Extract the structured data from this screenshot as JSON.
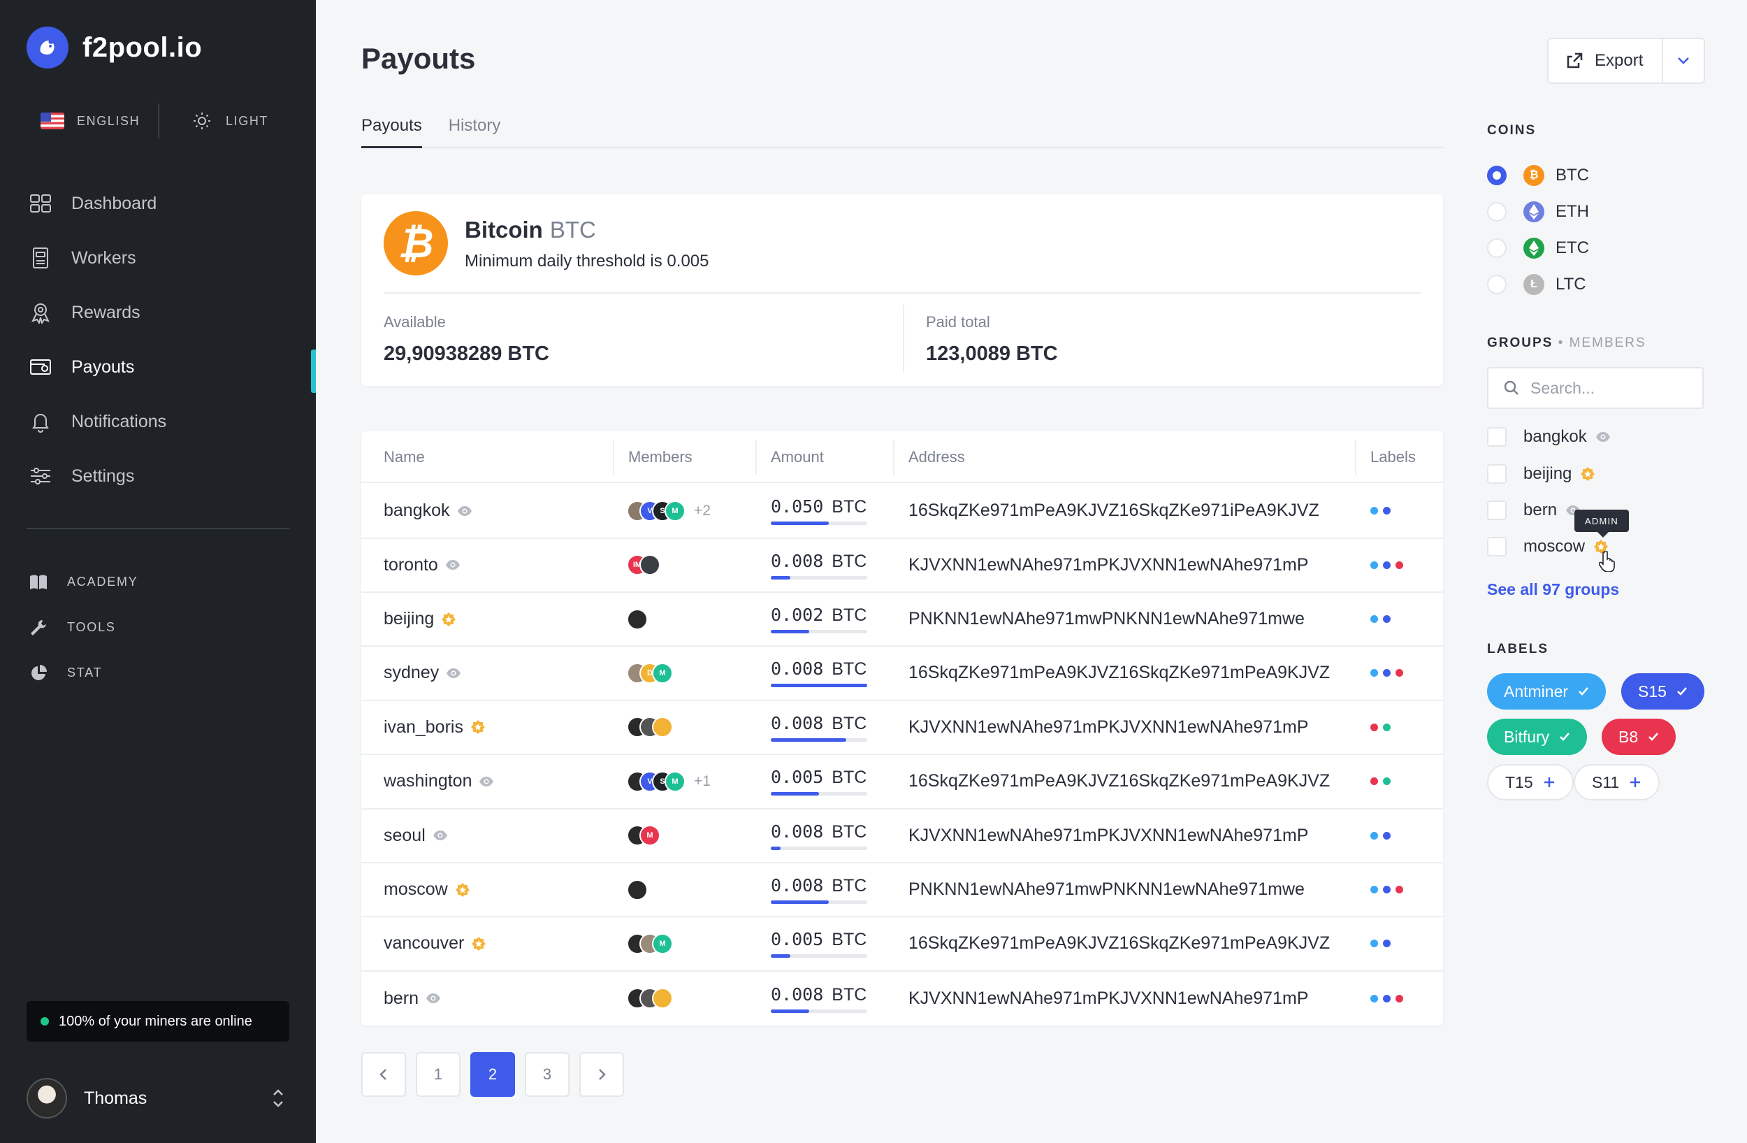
{
  "app": {
    "name": "f2pool.io"
  },
  "lang": {
    "label": "ENGLISH"
  },
  "theme": {
    "label": "LIGHT"
  },
  "nav": [
    {
      "label": "Dashboard"
    },
    {
      "label": "Workers"
    },
    {
      "label": "Rewards"
    },
    {
      "label": "Payouts"
    },
    {
      "label": "Notifications"
    },
    {
      "label": "Settings"
    }
  ],
  "subnav": [
    {
      "label": "ACADEMY"
    },
    {
      "label": "TOOLS"
    },
    {
      "label": "STAT"
    }
  ],
  "status": {
    "online_text": "100% of your miners are online",
    "color": "#21c88a"
  },
  "user": {
    "name": "Thomas"
  },
  "page": {
    "title": "Payouts",
    "export_label": "Export"
  },
  "tabs": [
    {
      "label": "Payouts",
      "active": true
    },
    {
      "label": "History",
      "active": false
    }
  ],
  "coin": {
    "name": "Bitcoin",
    "ticker": "BTC",
    "description": "Minimum daily threshold is 0.005",
    "available_label": "Available",
    "available_value": "29,90938289 BTC",
    "paid_label": "Paid total",
    "paid_value": "123,0089 BTC",
    "color": "#f7931a"
  },
  "table": {
    "headers": [
      "Name",
      "Members",
      "Amount",
      "Address",
      "Labels"
    ],
    "rows": [
      {
        "name": "bangkok",
        "icon": "eye-icon",
        "members": [
          {
            "t": "",
            "c": "#8a7a6a"
          },
          {
            "t": "V",
            "c": "#3f5bea"
          },
          {
            "t": "S",
            "c": "#1f2328"
          },
          {
            "t": "M",
            "c": "#1fbf96"
          }
        ],
        "extra": "+2",
        "amount": "0.050",
        "unit": "BTC",
        "progress": 0.6,
        "address": "16SkqZKe971mPeA9KJVZ16SkqZKe971iPeA9KJVZ",
        "labels": [
          "#3aa7f5",
          "#3f5bea"
        ]
      },
      {
        "name": "toronto",
        "icon": "eye-icon",
        "members": [
          {
            "t": "IM",
            "c": "#e8344e"
          },
          {
            "t": "",
            "c": "#3a3f46"
          }
        ],
        "extra": "",
        "amount": "0.008",
        "unit": "BTC",
        "progress": 0.2,
        "address": "KJVXNN1ewNAhe971mPKJVXNN1ewNAhe971mP",
        "labels": [
          "#3aa7f5",
          "#3f5bea",
          "#e8344e"
        ]
      },
      {
        "name": "beijing",
        "icon": "star-badge-icon",
        "members": [
          {
            "t": "",
            "c": "#2a2a2a"
          }
        ],
        "extra": "",
        "amount": "0.002",
        "unit": "BTC",
        "progress": 0.4,
        "address": "PNKNN1ewNAhe971mwPNKNN1ewNAhe971mwe",
        "labels": [
          "#3aa7f5",
          "#3f5bea"
        ]
      },
      {
        "name": "sydney",
        "icon": "eye-icon",
        "members": [
          {
            "t": "",
            "c": "#9a8a7a"
          },
          {
            "t": "D",
            "c": "#f2b233"
          },
          {
            "t": "M",
            "c": "#1fbf96"
          }
        ],
        "extra": "",
        "amount": "0.008",
        "unit": "BTC",
        "progress": 1.0,
        "address": "16SkqZKe971mPeA9KJVZ16SkqZKe971mPeA9KJVZ",
        "labels": [
          "#3aa7f5",
          "#3f5bea",
          "#e8344e"
        ]
      },
      {
        "name": "ivan_boris",
        "icon": "star-badge-icon",
        "members": [
          {
            "t": "",
            "c": "#2a2a2a"
          },
          {
            "t": "",
            "c": "#555"
          },
          {
            "t": "",
            "c": "#f2b233"
          }
        ],
        "extra": "",
        "amount": "0.008",
        "unit": "BTC",
        "progress": 0.78,
        "address": "KJVXNN1ewNAhe971mPKJVXNN1ewNAhe971mP",
        "labels": [
          "#e8344e",
          "#1fbf96"
        ]
      },
      {
        "name": "washington",
        "icon": "eye-icon",
        "members": [
          {
            "t": "",
            "c": "#2a2a2a"
          },
          {
            "t": "V",
            "c": "#3f5bea"
          },
          {
            "t": "S",
            "c": "#1f2328"
          },
          {
            "t": "M",
            "c": "#1fbf96"
          }
        ],
        "extra": "+1",
        "amount": "0.005",
        "unit": "BTC",
        "progress": 0.5,
        "address": "16SkqZKe971mPeA9KJVZ16SkqZKe971mPeA9KJVZ",
        "labels": [
          "#e8344e",
          "#1fbf96"
        ]
      },
      {
        "name": "seoul",
        "icon": "eye-icon",
        "members": [
          {
            "t": "",
            "c": "#2a2a2a"
          },
          {
            "t": "M",
            "c": "#e8344e"
          }
        ],
        "extra": "",
        "amount": "0.008",
        "unit": "BTC",
        "progress": 0.1,
        "address": "KJVXNN1ewNAhe971mPKJVXNN1ewNAhe971mP",
        "labels": [
          "#3aa7f5",
          "#3f5bea"
        ]
      },
      {
        "name": "moscow",
        "icon": "star-badge-icon",
        "members": [
          {
            "t": "",
            "c": "#2a2a2a"
          }
        ],
        "extra": "",
        "amount": "0.008",
        "unit": "BTC",
        "progress": 0.6,
        "address": "PNKNN1ewNAhe971mwPNKNN1ewNAhe971mwe",
        "labels": [
          "#3aa7f5",
          "#3f5bea",
          "#e8344e"
        ]
      },
      {
        "name": "vancouver",
        "icon": "star-badge-icon",
        "members": [
          {
            "t": "",
            "c": "#2a2a2a"
          },
          {
            "t": "",
            "c": "#9a8a7a"
          },
          {
            "t": "M",
            "c": "#1fbf96"
          }
        ],
        "extra": "",
        "amount": "0.005",
        "unit": "BTC",
        "progress": 0.2,
        "address": "16SkqZKe971mPeA9KJVZ16SkqZKe971mPeA9KJVZ",
        "labels": [
          "#3aa7f5",
          "#3f5bea"
        ]
      },
      {
        "name": "bern",
        "icon": "eye-icon",
        "members": [
          {
            "t": "",
            "c": "#2a2a2a"
          },
          {
            "t": "",
            "c": "#555"
          },
          {
            "t": "",
            "c": "#f2b233"
          }
        ],
        "extra": "",
        "amount": "0.008",
        "unit": "BTC",
        "progress": 0.4,
        "address": "KJVXNN1ewNAhe971mPKJVXNN1ewNAhe971mP",
        "labels": [
          "#3aa7f5",
          "#3f5bea",
          "#e8344e"
        ]
      }
    ]
  },
  "pagination": {
    "pages": [
      "1",
      "2",
      "3"
    ],
    "current": "2"
  },
  "right": {
    "coins_heading": "COINS",
    "coins": [
      {
        "label": "BTC",
        "selected": true,
        "color": "#f7931a",
        "icon": "bitcoin-icon"
      },
      {
        "label": "ETH",
        "selected": false,
        "color": "#6f7fe0",
        "icon": "ethereum-icon"
      },
      {
        "label": "ETC",
        "selected": false,
        "color": "#1fa34a",
        "icon": "ethereum-classic-icon"
      },
      {
        "label": "LTC",
        "selected": false,
        "color": "#b8b8b8",
        "icon": "litecoin-icon"
      }
    ],
    "groups_heading": "GROUPS",
    "members_heading": "MEMBERS",
    "search_placeholder": "Search...",
    "groups": [
      {
        "label": "bangkok",
        "icon": "eye-icon"
      },
      {
        "label": "beijing",
        "icon": "star-badge-icon"
      },
      {
        "label": "bern",
        "icon": "eye-icon"
      },
      {
        "label": "moscow",
        "icon": "star-badge-icon"
      }
    ],
    "tooltip": "ADMIN",
    "see_all": "See all 97 groups",
    "labels_heading": "LABELS",
    "labels": [
      {
        "label": "Antminer",
        "color": "#3aa7f5",
        "state": "selected"
      },
      {
        "label": "S15",
        "color": "#3f5bea",
        "state": "selected"
      },
      {
        "label": "Bitfury",
        "color": "#1fbf96",
        "state": "selected"
      },
      {
        "label": "B8",
        "color": "#e8344e",
        "state": "selected"
      },
      {
        "label": "T15",
        "color": "#3f5bea",
        "state": "add"
      },
      {
        "label": "S11",
        "color": "#3f5bea",
        "state": "add"
      }
    ]
  }
}
